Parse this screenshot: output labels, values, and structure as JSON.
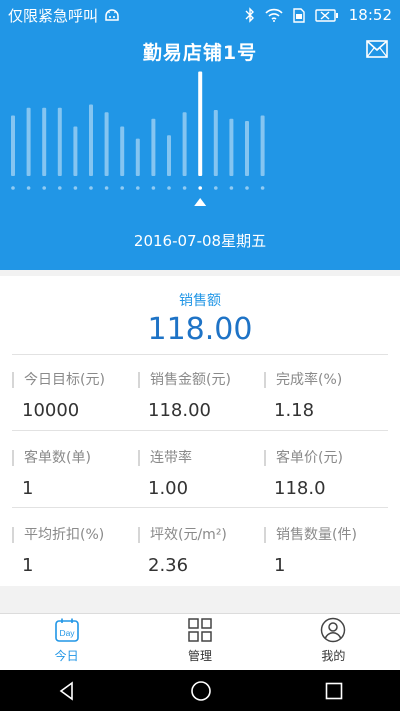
{
  "status_bar": {
    "left_text": "仅限紧急呼叫",
    "time": "18:52"
  },
  "header": {
    "title": "勤易店铺1号",
    "date": "2016-07-08星期五",
    "selected_index": 12,
    "bar_levels": [
      0.55,
      0.62,
      0.62,
      0.62,
      0.45,
      0.65,
      0.58,
      0.45,
      0.34,
      0.52,
      0.37,
      0.58,
      0.95,
      0.6,
      0.52,
      0.5,
      0.55
    ]
  },
  "summary": {
    "label": "销售额",
    "value": "118.00"
  },
  "metrics": [
    {
      "label": "今日目标(元)",
      "value": "10000"
    },
    {
      "label": "销售金额(元)",
      "value": "118.00"
    },
    {
      "label": "完成率(%)",
      "value": "1.18"
    },
    {
      "label": "客单数(单)",
      "value": "1"
    },
    {
      "label": "连带率",
      "value": "1.00"
    },
    {
      "label": "客单价(元)",
      "value": "118.0"
    },
    {
      "label": "平均折扣(%)",
      "value": "1"
    },
    {
      "label": "坪效(元/m²)",
      "value": "2.36"
    },
    {
      "label": "销售数量(件)",
      "value": "1"
    }
  ],
  "nav": [
    {
      "label": "今日",
      "icon": "calendar-day-icon",
      "icon_text": "Day",
      "active": true
    },
    {
      "label": "管理",
      "icon": "grid-icon",
      "active": false
    },
    {
      "label": "我的",
      "icon": "user-icon",
      "active": false
    }
  ],
  "colors": {
    "primary": "#2196e6",
    "value_blue": "#1e73c6"
  }
}
